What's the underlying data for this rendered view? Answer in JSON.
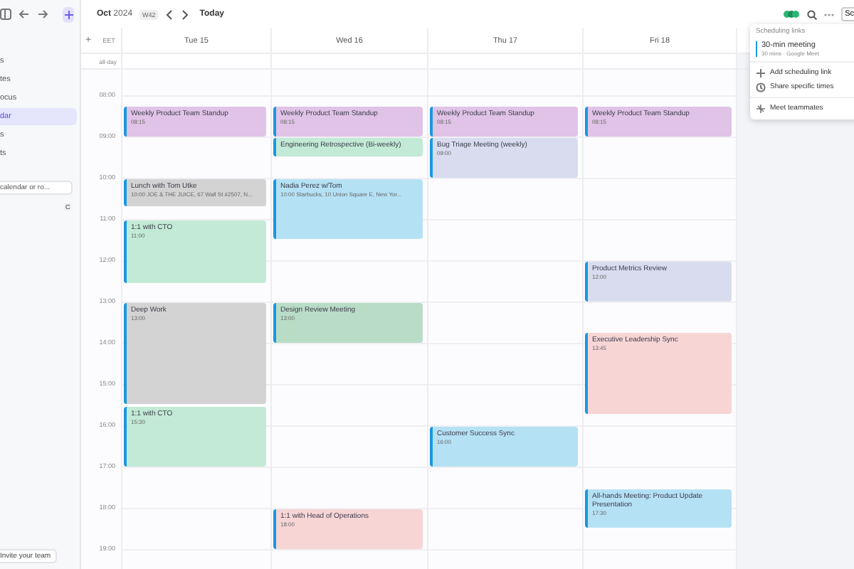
{
  "sidebar": {
    "items": [
      {
        "label": "s",
        "selected": false
      },
      {
        "label": "tes",
        "selected": false
      },
      {
        "label": "ocus",
        "selected": false
      },
      {
        "label": "dar",
        "selected": true
      },
      {
        "label": "s",
        "selected": false
      },
      {
        "label": "ts",
        "selected": false
      }
    ],
    "search": {
      "placeholder": "calendar or ro...",
      "shortcut": "C"
    },
    "invite_button": "Invite your team"
  },
  "toolbar": {
    "month": "Oct",
    "year": "2024",
    "week": "W42",
    "today_button": "Today",
    "schedule_button": "Sc"
  },
  "header": {
    "add": "+",
    "timezone": "EET",
    "all_day": "all-day"
  },
  "time_labels": [
    "08:00",
    "09:00",
    "10:00",
    "11:00",
    "12:00",
    "13:00",
    "14:00",
    "15:00",
    "16:00",
    "17:00",
    "18:00",
    "19:00"
  ],
  "days": [
    {
      "label": "Tue 15",
      "events": [
        {
          "title": "Weekly Product Team Standup",
          "time": "08:15",
          "color": "#e0c3e6"
        },
        {
          "title": "Lunch with Tom Utke",
          "time": "10:00 JOE & THE JUICE, 67 Wall St #2507, N...",
          "color": "#d3d3d3"
        },
        {
          "title": "1:1 with CTO",
          "time": "11:00",
          "color": "#c2ead6"
        },
        {
          "title": "Deep Work",
          "time": "13:00",
          "color": "#d3d3d3"
        },
        {
          "title": "1:1 with CTO",
          "time": "15:30",
          "color": "#c2ead6"
        }
      ]
    },
    {
      "label": "Wed 16",
      "events": [
        {
          "title": "Weekly Product Team Standup",
          "time": "08:15",
          "color": "#e0c3e6"
        },
        {
          "title": "Engineering Retrospective (Bi-weekly)",
          "color": "#c2ead6"
        },
        {
          "title": "Nadia Perez w/Tom",
          "time": "10:00 Starbucks, 10 Union Square E, New Yor...",
          "color": "#b5e1f5"
        },
        {
          "title": "Design Review Meeting",
          "time": "13:00",
          "color": "#b9dcc6"
        },
        {
          "title": "1:1 with Head of Operations",
          "time": "18:00",
          "color": "#f7d5d5"
        }
      ]
    },
    {
      "label": "Thu 17",
      "events": [
        {
          "title": "Weekly Product Team Standup",
          "time": "08:15",
          "color": "#e0c3e6"
        },
        {
          "title": "Bug Triage Meeting (weekly)",
          "time": "09:00",
          "color": "#d8dcee"
        },
        {
          "title": "Customer Success Sync",
          "time": "16:00",
          "color": "#b5e1f5"
        }
      ]
    },
    {
      "label": "Fri 18",
      "events": [
        {
          "title": "Weekly Product Team Standup",
          "time": "08:15",
          "color": "#e0c3e6"
        },
        {
          "title": "Product Metrics Review",
          "time": "12:00",
          "color": "#d8dcee"
        },
        {
          "title": "Executive Leadership Sync",
          "time": "13:45",
          "color": "#f7d5d5"
        },
        {
          "title": "All-hands Meeting: Product Update Presentation",
          "time": "17:30",
          "color": "#b5e1f5"
        }
      ]
    }
  ],
  "popover": {
    "heading": "Scheduling links",
    "link": {
      "title": "30-min meeting",
      "detail": "30 mins · Google Meet"
    },
    "actions": [
      {
        "kind": "add",
        "label": "Add scheduling link"
      },
      {
        "kind": "share",
        "label": "Share specific times"
      },
      {
        "kind": "meet",
        "label": "Meet teammates"
      }
    ]
  }
}
